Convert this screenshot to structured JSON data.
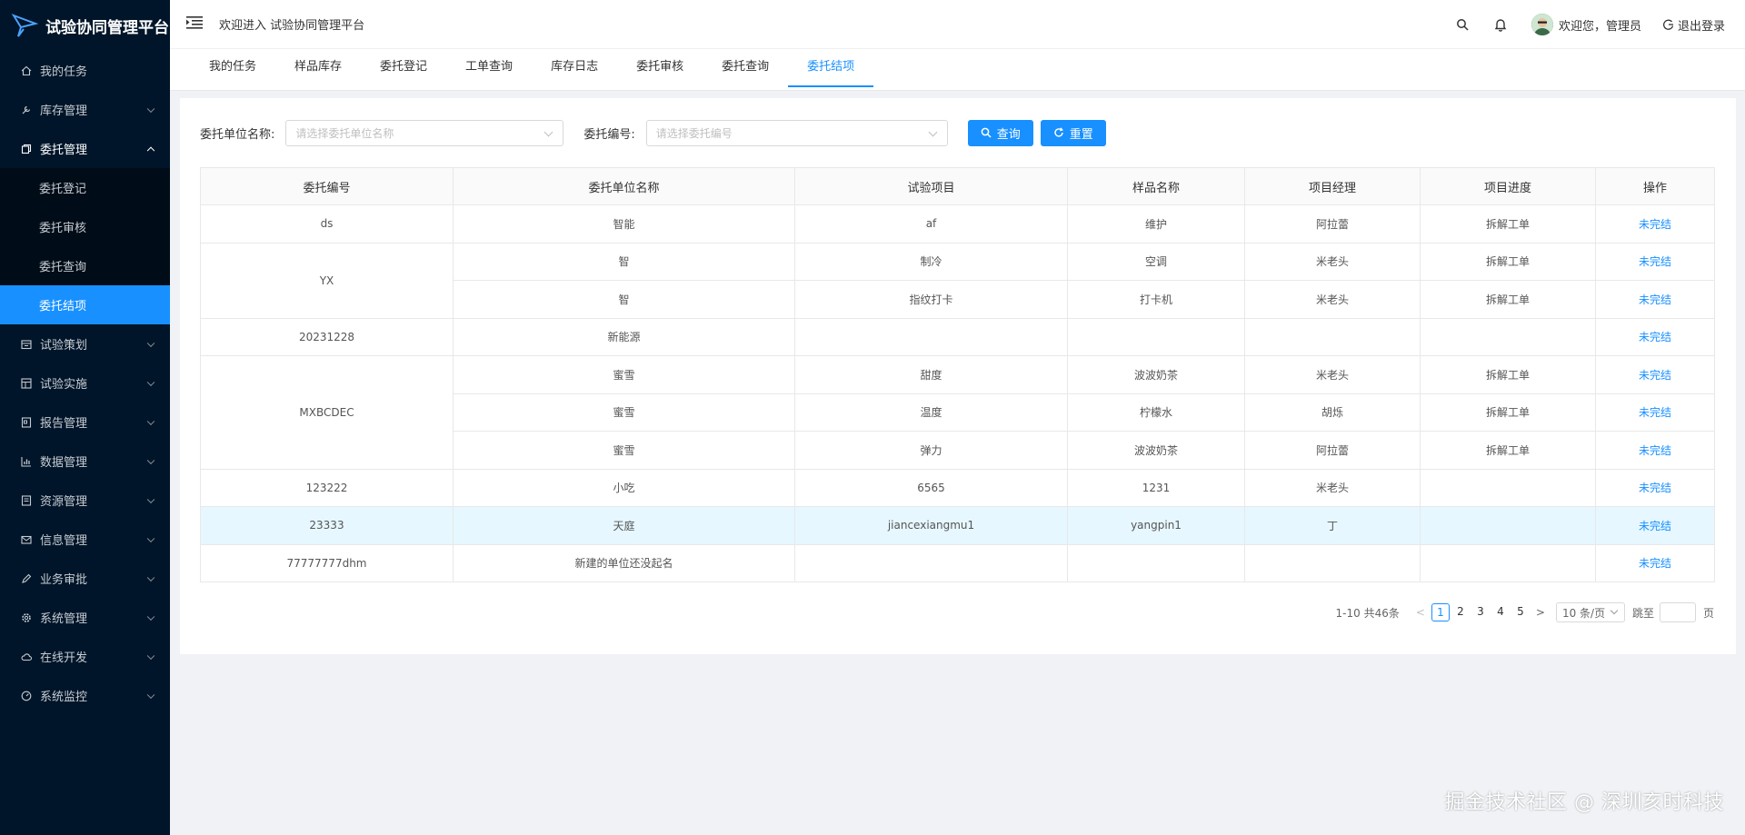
{
  "app": {
    "title": "试验协同管理平台"
  },
  "header": {
    "welcome": "欢迎进入 试验协同管理平台",
    "user_greeting": "欢迎您，管理员",
    "logout": "退出登录"
  },
  "sidebar": {
    "items": [
      {
        "label": "我的任务",
        "icon": "home-icon"
      },
      {
        "label": "库存管理",
        "icon": "wrench-icon"
      },
      {
        "label": "委托管理",
        "icon": "copy-icon"
      },
      {
        "label": "试验策划",
        "icon": "calendar-icon"
      },
      {
        "label": "试验实施",
        "icon": "grid-icon"
      },
      {
        "label": "报告管理",
        "icon": "report-icon"
      },
      {
        "label": "数据管理",
        "icon": "bar-chart-icon"
      },
      {
        "label": "资源管理",
        "icon": "list-icon"
      },
      {
        "label": "信息管理",
        "icon": "mail-icon"
      },
      {
        "label": "业务审批",
        "icon": "pen-icon"
      },
      {
        "label": "系统管理",
        "icon": "gear-icon"
      },
      {
        "label": "在线开发",
        "icon": "cloud-icon"
      },
      {
        "label": "系统监控",
        "icon": "dashboard-icon"
      }
    ],
    "submenu": [
      {
        "label": "委托登记"
      },
      {
        "label": "委托审核"
      },
      {
        "label": "委托查询"
      },
      {
        "label": "委托结项"
      }
    ]
  },
  "tabs": [
    "我的任务",
    "样品库存",
    "委托登记",
    "工单查询",
    "库存日志",
    "委托审核",
    "委托查询",
    "委托结项"
  ],
  "search": {
    "unit_label": "委托单位名称:",
    "unit_placeholder": "请选择委托单位名称",
    "code_label": "委托编号:",
    "code_placeholder": "请选择委托编号",
    "query_button": "查询",
    "reset_button": "重置"
  },
  "table": {
    "headers": [
      "委托编号",
      "委托单位名称",
      "试验项目",
      "样品名称",
      "项目经理",
      "项目进度",
      "操作"
    ],
    "groups": [
      {
        "code": "ds",
        "rows": [
          {
            "unit": "智能",
            "item": "af",
            "sample": "维护",
            "manager": "阿拉蕾",
            "progress": "拆解工单",
            "action": "未完结"
          }
        ]
      },
      {
        "code": "YX",
        "rows": [
          {
            "unit": "智",
            "item": "制冷",
            "sample": "空调",
            "manager": "米老头",
            "progress": "拆解工单",
            "action": "未完结"
          },
          {
            "unit": "智",
            "item": "指纹打卡",
            "sample": "打卡机",
            "manager": "米老头",
            "progress": "拆解工单",
            "action": "未完结"
          }
        ]
      },
      {
        "code": "20231228",
        "rows": [
          {
            "unit": "新能源",
            "item": "",
            "sample": "",
            "manager": "",
            "progress": "",
            "action": "未完结"
          }
        ]
      },
      {
        "code": "MXBCDEC",
        "rows": [
          {
            "unit": "蜜雪",
            "item": "甜度",
            "sample": "波波奶茶",
            "manager": "米老头",
            "progress": "拆解工单",
            "action": "未完结"
          },
          {
            "unit": "蜜雪",
            "item": "温度",
            "sample": "柠檬水",
            "manager": "胡烁",
            "progress": "拆解工单",
            "action": "未完结"
          },
          {
            "unit": "蜜雪",
            "item": "弹力",
            "sample": "波波奶茶",
            "manager": "阿拉蕾",
            "progress": "拆解工单",
            "action": "未完结"
          }
        ]
      },
      {
        "code": "123222",
        "rows": [
          {
            "unit": "小吃",
            "item": "6565",
            "sample": "1231",
            "manager": "米老头",
            "progress": "",
            "action": "未完结"
          }
        ]
      },
      {
        "code": "23333",
        "highlight": true,
        "rows": [
          {
            "unit": "天庭",
            "item": "jiancexiangmu1",
            "sample": "yangpin1",
            "manager": "丁",
            "progress": "",
            "action": "未完结"
          }
        ]
      },
      {
        "code": "77777777dhm",
        "rows": [
          {
            "unit": "新建的单位还没起名",
            "item": "",
            "sample": "",
            "manager": "",
            "progress": "",
            "action": "未完结"
          }
        ]
      }
    ]
  },
  "pagination": {
    "total": "1-10 共46条",
    "pages": [
      "1",
      "2",
      "3",
      "4",
      "5"
    ],
    "current": "1",
    "page_size": "10 条/页",
    "jump_label": "跳至",
    "page_suffix": "页"
  },
  "watermark": "掘金技术社区 @ 深圳亥时科技",
  "colors": {
    "sidebar_bg": "#001529",
    "accent": "#1890ff"
  }
}
